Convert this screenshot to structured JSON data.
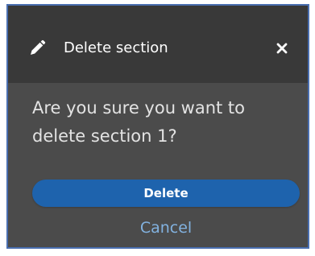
{
  "dialog": {
    "title": "Delete section",
    "message": "Are you sure you want to delete section 1?",
    "delete_label": "Delete",
    "cancel_label": "Cancel"
  },
  "icons": {
    "header": "pencil-icon",
    "close": "close-icon"
  },
  "colors": {
    "header_background": "#393939",
    "dialog_background": "#4b4b4b",
    "border": "#4a6fb0",
    "primary_button": "#1e63ad",
    "cancel_link": "#82b2e0"
  }
}
